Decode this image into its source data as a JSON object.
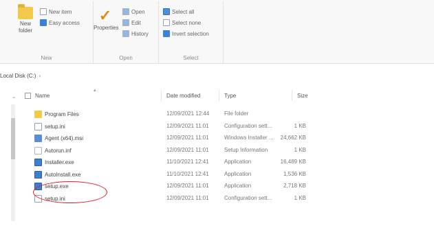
{
  "ribbon": {
    "new_group": {
      "label": "New",
      "new_folder": "New folder",
      "new_item": "New item",
      "easy_access": "Easy access"
    },
    "open_group": {
      "label": "Open",
      "properties": "Properties",
      "open": "Open",
      "edit": "Edit",
      "history": "History"
    },
    "select_group": {
      "label": "Select",
      "select_all": "Select all",
      "select_none": "Select none",
      "invert_selection": "Invert selection"
    }
  },
  "address": {
    "path": "Local Disk (C:)",
    "separator": "›"
  },
  "columns": {
    "name": "Name",
    "date_modified": "Date modified",
    "type": "Type",
    "size": "Size"
  },
  "files": [
    {
      "name": "Program Files",
      "date": "12/09/2021 12:44",
      "type": "File folder",
      "size": "",
      "icon": "folder-icon"
    },
    {
      "name": "setup.ini",
      "date": "12/09/2021 11:01",
      "type": "Configuration sett...",
      "size": "1 KB",
      "icon": "config-file-icon"
    },
    {
      "name": "Agent (x64).msi",
      "date": "12/09/2021 11:01",
      "type": "Windows Installer ...",
      "size": "24,662 KB",
      "icon": "installer-icon"
    },
    {
      "name": "Autorun.inf",
      "date": "12/09/2021 11:01",
      "type": "Setup Information",
      "size": "1 KB",
      "icon": "script-file-icon"
    },
    {
      "name": "Installer.exe",
      "date": "11/10/2021 12:41",
      "type": "Application",
      "size": "16,489 KB",
      "icon": "app-icon"
    },
    {
      "name": "AutoInstall.exe",
      "date": "11/10/2021 12:41",
      "type": "Application",
      "size": "1,536 KB",
      "icon": "app-icon"
    },
    {
      "name": "setup.exe",
      "date": "12/09/2021 11:01",
      "type": "Application",
      "size": "2,718 KB",
      "icon": "app-icon"
    },
    {
      "name": "setup.ini",
      "date": "12/09/2021 11:01",
      "type": "Configuration sett...",
      "size": "1 KB",
      "icon": "config-file-icon"
    }
  ],
  "highlight_color": "#e02020",
  "folder_color": "#f2c94c",
  "accent_color": "#3b82d6"
}
